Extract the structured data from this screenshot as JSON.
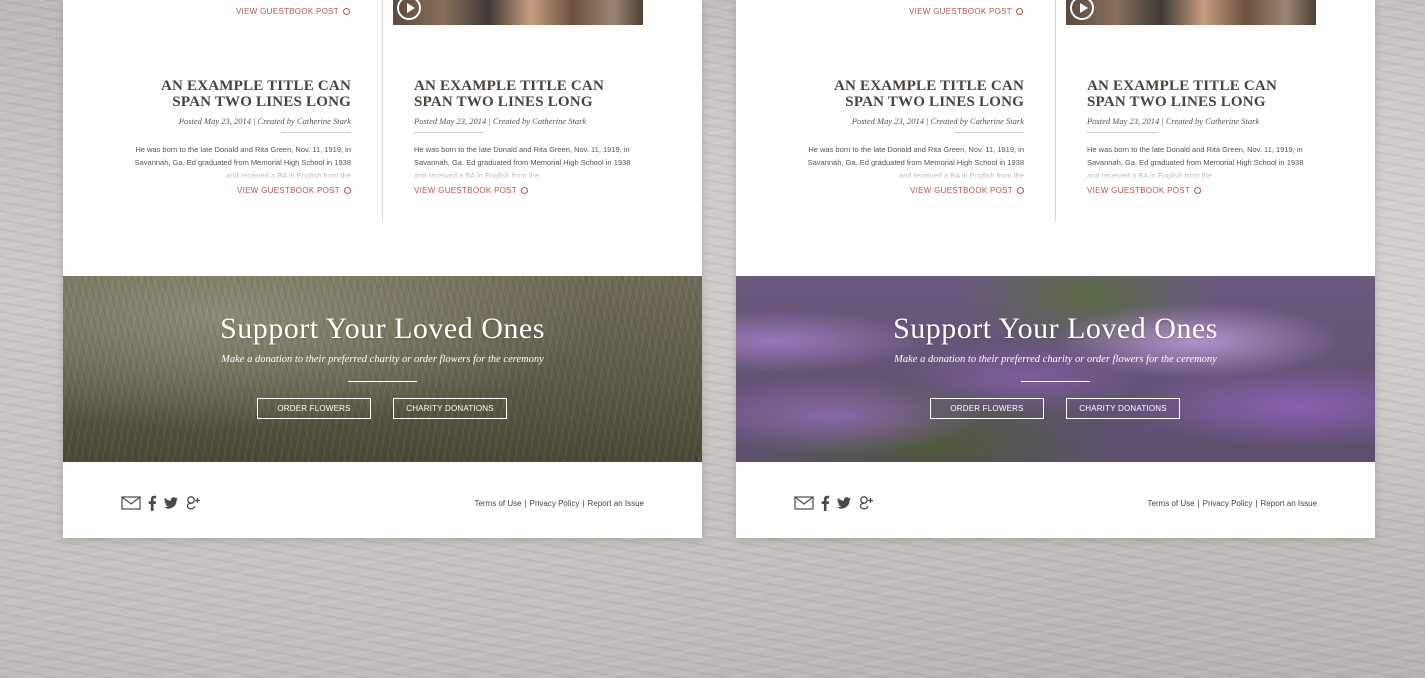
{
  "panels": [
    {
      "theme": "wheat",
      "top_link": "VIEW GUESTBOOK POST",
      "posts": [
        {
          "title": "AN EXAMPLE TITLE CAN SPAN TWO LINES LONG",
          "meta": "Posted May 23, 2014  |  Created by Catherine Stark",
          "body": "He was born to the late Donald and Rita Green, Nov. 11, 1919, in Savannah, Ga. Ed graduated from Memorial High School in 1938 and received a BA in English from the",
          "link": "VIEW GUESTBOOK POST"
        },
        {
          "title": "AN EXAMPLE TITLE CAN SPAN TWO LINES LONG",
          "meta": "Posted May 23, 2014  |  Created by Catherine Stark",
          "body": "He was born to the late Donald and Rita Green, Nov. 11, 1919, in Savannah, Ga. Ed graduated from Memorial High School in 1938 and received a BA in English from the",
          "link": "VIEW GUESTBOOK POST"
        }
      ],
      "banner": {
        "title": "Support Your Loved Ones",
        "subtitle": "Make a donation to their preferred charity or order flowers for the ceremony",
        "order_button": "ORDER FLOWERS",
        "charity_button": "CHARITY DONATIONS"
      },
      "footer": {
        "links": [
          "Terms of Use",
          "Privacy Policy",
          "Report an Issue"
        ],
        "separator": "|",
        "icons": [
          "mail-icon",
          "facebook-icon",
          "twitter-icon",
          "google-plus-icon"
        ]
      }
    },
    {
      "theme": "flower",
      "top_link": "VIEW GUESTBOOK POST",
      "posts": [
        {
          "title": "AN EXAMPLE TITLE CAN SPAN TWO LINES LONG",
          "meta": "Posted May 23, 2014  |  Created by Catherine Stark",
          "body": "He was born to the late Donald and Rita Green, Nov. 11, 1919, in Savannah, Ga. Ed graduated from Memorial High School in 1938 and received a BA in English from the",
          "link": "VIEW GUESTBOOK POST"
        },
        {
          "title": "AN EXAMPLE TITLE CAN SPAN TWO LINES LONG",
          "meta": "Posted May 23, 2014  |  Created by Catherine Stark",
          "body": "He was born to the late Donald and Rita Green, Nov. 11, 1919, in Savannah, Ga. Ed graduated from Memorial High School in 1938 and received a BA in English from the",
          "link": "VIEW GUESTBOOK POST"
        }
      ],
      "banner": {
        "title": "Support Your Loved Ones",
        "subtitle": "Make a donation to their preferred charity or order flowers for the ceremony",
        "order_button": "ORDER FLOWERS",
        "charity_button": "CHARITY DONATIONS"
      },
      "footer": {
        "links": [
          "Terms of Use",
          "Privacy Policy",
          "Report an Issue"
        ],
        "separator": "|",
        "icons": [
          "mail-icon",
          "facebook-icon",
          "twitter-icon",
          "google-plus-icon"
        ]
      }
    }
  ],
  "colors": {
    "accent_link": "#b9534c",
    "heading": "#4a4338",
    "panel_bg": "#ffffff"
  }
}
